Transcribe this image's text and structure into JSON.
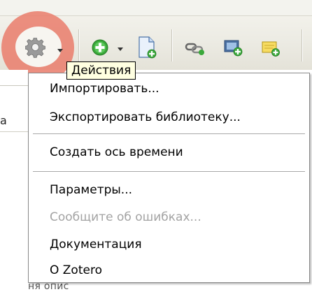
{
  "toolbar": {
    "actions_tooltip": "Действия",
    "icons": [
      "gear-icon",
      "new-item-icon",
      "new-note-icon",
      "link-icon",
      "snapshot-icon",
      "note-icon"
    ]
  },
  "menu": {
    "items": [
      {
        "label": "Импортировать...",
        "enabled": true
      },
      {
        "label": "Экспортировать библиотеку...",
        "enabled": true
      },
      {
        "label": "Создать ось времени",
        "enabled": true
      },
      {
        "label": "Параметры...",
        "enabled": true
      },
      {
        "label": "Сообщите об ошибках...",
        "enabled": false
      },
      {
        "label": "Документация",
        "enabled": true
      },
      {
        "label": "О Zotero",
        "enabled": true
      }
    ]
  },
  "background": {
    "left_edge_text": "а",
    "bottom_text": "ня опис"
  },
  "colors": {
    "highlight": "#e97f6e",
    "tooltip_bg": "#ffffe1",
    "disabled_text": "#a3a3a3",
    "add_icon_green": "#3aa83a"
  }
}
